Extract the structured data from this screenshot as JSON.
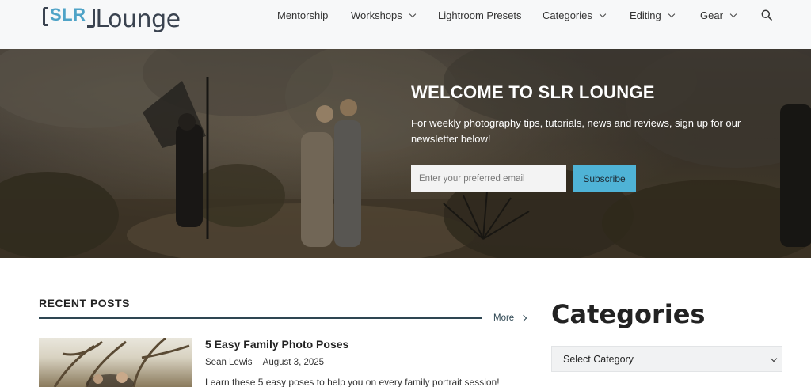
{
  "brand": {
    "logo_mark": "SLR",
    "logo_word": "Lounge"
  },
  "nav": {
    "items": [
      {
        "label": "Mentorship",
        "has_dropdown": false
      },
      {
        "label": "Workshops",
        "has_dropdown": true
      },
      {
        "label": "Lightroom Presets",
        "has_dropdown": false
      },
      {
        "label": "Categories",
        "has_dropdown": true
      },
      {
        "label": "Editing",
        "has_dropdown": true
      },
      {
        "label": "Gear",
        "has_dropdown": true
      }
    ],
    "search_icon": "search-icon"
  },
  "hero": {
    "title": "WELCOME TO SLR LOUNGE",
    "subtitle": "For weekly photography tips, tutorials, news and reviews, sign up for our newsletter below!",
    "email_placeholder": "Enter your preferred email",
    "subscribe_label": "Subscribe"
  },
  "recent_posts": {
    "heading": "RECENT POSTS",
    "more_label": "More",
    "posts": [
      {
        "title": "5 Easy Family Photo Poses",
        "author": "Sean Lewis",
        "date": "August 3, 2025",
        "excerpt": "Learn these 5 easy poses to help you on every family portrait session!"
      }
    ]
  },
  "sidebar": {
    "categories_heading": "Categories",
    "category_select_value": "Select Category"
  },
  "colors": {
    "accent": "#4fb3d6",
    "brand_dark": "#3a4350",
    "divider": "#2e4652"
  }
}
